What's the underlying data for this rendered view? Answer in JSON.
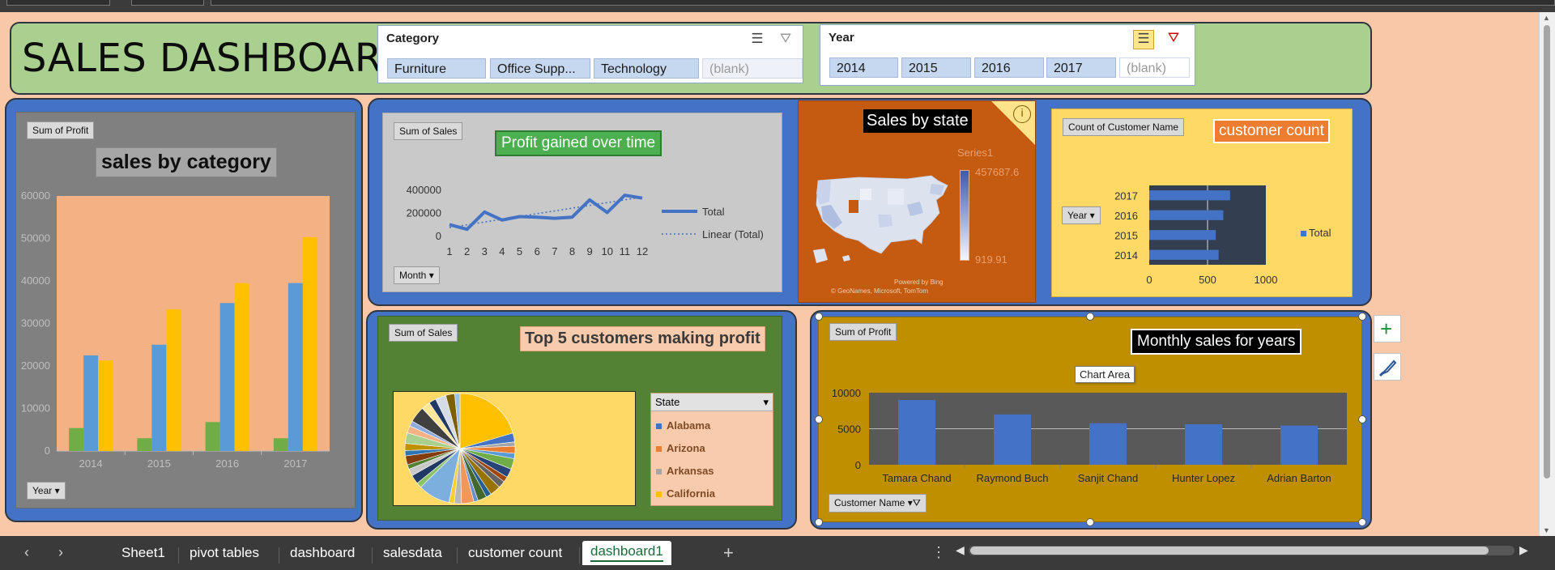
{
  "app": {
    "accent": "#4472c4"
  },
  "dashboard": {
    "title": "SALES DASHBOARD"
  },
  "slicers": {
    "category": {
      "header": "Category",
      "items": [
        "Furniture",
        "Office Supp...",
        "Technology",
        "(blank)"
      ],
      "icons": [
        "multi-select-icon",
        "clear-filter-icon"
      ]
    },
    "year": {
      "header": "Year",
      "items": [
        "2014",
        "2015",
        "2016",
        "2017",
        "(blank)"
      ],
      "icons": [
        "multi-select-icon",
        "clear-filter-icon"
      ]
    }
  },
  "charts": {
    "category": {
      "field": "Sum of Profit",
      "title": "sales by category",
      "filter_button": "Year",
      "colors": {
        "plot_bg": "#f4b183",
        "s1": "#70ad47",
        "s2": "#5b9bd5",
        "s3": "#ffc000"
      }
    },
    "profit_time": {
      "field": "Sum of Sales",
      "title": "Profit gained over time",
      "filter_button": "Month",
      "legend": [
        "Total",
        "Linear (Total)"
      ]
    },
    "state": {
      "title": "Sales by state",
      "series": "Series1",
      "max_label": "457687.6",
      "min_label": "919.91",
      "credit_1": "Powered by Bing",
      "credit_2": "© GeoNames, Microsoft, TomTom"
    },
    "customer": {
      "field": "Count of Customer Name",
      "title": "customer count",
      "filter_button": "Year",
      "legend": "Total"
    },
    "top5": {
      "field": "Sum of Sales",
      "title": "Top 5 customers making profit",
      "legend_header": "State",
      "legend_items": [
        "Alabama",
        "Arizona",
        "Arkansas",
        "California"
      ]
    },
    "monthly": {
      "field": "Sum of Profit",
      "title": "Monthly sales for years",
      "tooltip": "Chart Area",
      "filter_button": "Customer Name"
    }
  },
  "chart_data": [
    {
      "type": "bar",
      "title": "sales by category",
      "categories": [
        "2014",
        "2015",
        "2016",
        "2017"
      ],
      "series": [
        {
          "values": [
            5400,
            3000,
            6800,
            3000
          ]
        },
        {
          "values": [
            22500,
            25000,
            34800,
            39500
          ]
        },
        {
          "values": [
            21300,
            33300,
            39500,
            50300
          ]
        }
      ],
      "ylim": [
        0,
        60000
      ],
      "yticks": [
        "0",
        "10000",
        "20000",
        "30000",
        "40000",
        "50000",
        "60000"
      ]
    },
    {
      "type": "line",
      "title": "Profit gained over time",
      "x": [
        "1",
        "2",
        "3",
        "4",
        "5",
        "6",
        "7",
        "8",
        "9",
        "10",
        "11",
        "12"
      ],
      "series": [
        {
          "name": "Total",
          "values": [
            95000,
            55000,
            205000,
            135000,
            165000,
            160000,
            150000,
            160000,
            310000,
            200000,
            350000,
            325000
          ]
        },
        {
          "name": "Linear (Total)",
          "values": [
            70000,
            94000,
            118000,
            142000,
            166000,
            190000,
            214000,
            238000,
            262000,
            286000,
            310000,
            334000
          ]
        }
      ],
      "ylim": [
        0,
        400000
      ],
      "yticks": [
        "0",
        "200000",
        "400000"
      ]
    },
    {
      "type": "bar",
      "title": "customer count",
      "orientation": "horizontal",
      "categories": [
        "2014",
        "2015",
        "2016",
        "2017"
      ],
      "series": [
        {
          "name": "Total",
          "values": [
            595,
            570,
            635,
            693
          ]
        }
      ],
      "xlim": [
        0,
        1000
      ],
      "xticks": [
        "0",
        "500",
        "1000"
      ]
    },
    {
      "type": "pie",
      "title": "Top 5 customers making profit",
      "legend_visible": [
        "Alabama",
        "Arizona",
        "Arkansas",
        "California"
      ],
      "slices": [
        19.6,
        2.5,
        1.2,
        2.0,
        1.5,
        3.0,
        2.5,
        1.5,
        2.0,
        3.0,
        1.5,
        2.5,
        1.2,
        3.5,
        2.0,
        1.5,
        9.0,
        1.5,
        2.5,
        2.0,
        1.3,
        2.5,
        1.5,
        2.0,
        3.0,
        2.0,
        1.5,
        4.5,
        2.5,
        2.0,
        3.0,
        2.5,
        1.5
      ]
    },
    {
      "type": "bar",
      "title": "Monthly sales for years",
      "categories": [
        "Tamara Chand",
        "Raymond Buch",
        "Sanjit Chand",
        "Hunter Lopez",
        "Adrian Barton"
      ],
      "series": [
        {
          "values": [
            8980,
            6980,
            5760,
            5620,
            5440
          ]
        }
      ],
      "ylim": [
        0,
        10000
      ],
      "yticks": [
        "0",
        "5000",
        "10000"
      ]
    }
  ],
  "sheets": {
    "tabs": [
      "Sheet1",
      "pivot tables",
      "dashboard",
      "salesdata",
      "customer count",
      "dashboard1"
    ],
    "active": "dashboard1",
    "add_label": "+",
    "more_label": "⋮"
  }
}
